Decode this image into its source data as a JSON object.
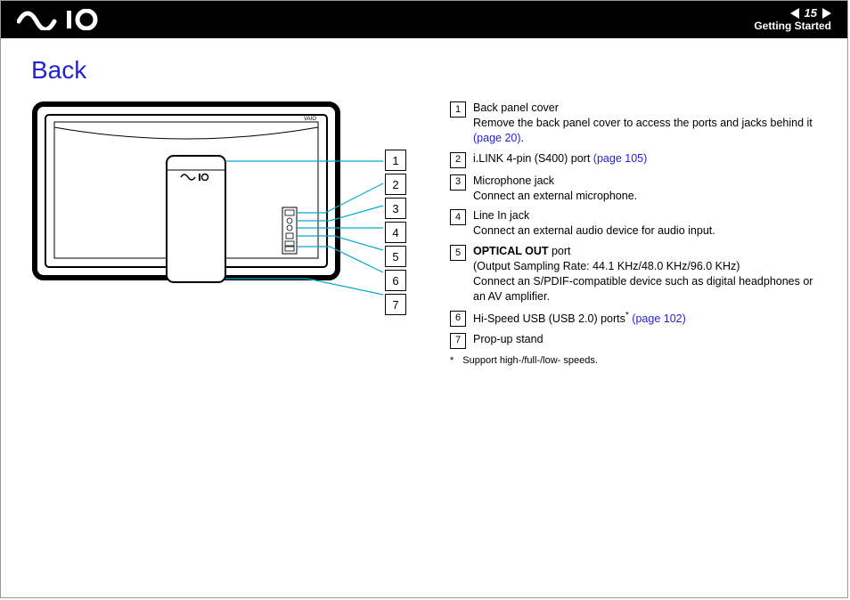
{
  "header": {
    "page_number": "15",
    "section": "Getting Started"
  },
  "title": "Back",
  "callouts": [
    "1",
    "2",
    "3",
    "4",
    "5",
    "6",
    "7"
  ],
  "items": [
    {
      "n": "1",
      "line1": "Back panel cover",
      "line2_pre": "Remove the back panel cover to access the ports and jacks behind it ",
      "link": "(page 20)",
      "line2_post": "."
    },
    {
      "n": "2",
      "line1_pre": "i.LINK 4-pin (S400) port ",
      "link": "(page 105)"
    },
    {
      "n": "3",
      "line1": "Microphone jack",
      "line2": "Connect an external microphone."
    },
    {
      "n": "4",
      "line1": "Line In jack",
      "line2": "Connect an external audio device for audio input."
    },
    {
      "n": "5",
      "bold": "OPTICAL OUT",
      "after_bold": " port",
      "line2": "(Output Sampling Rate: 44.1 KHz/48.0 KHz/96.0 KHz)",
      "line3": "Connect an S/PDIF-compatible device such as digital headphones or an AV amplifier."
    },
    {
      "n": "6",
      "line1_pre": "Hi-Speed USB (USB 2.0) ports",
      "sup": "*",
      "space": " ",
      "link": "(page 102)"
    },
    {
      "n": "7",
      "line1": "Prop-up stand"
    }
  ],
  "footnote": {
    "star": "*",
    "text": "Support high-/full-/low- speeds."
  }
}
